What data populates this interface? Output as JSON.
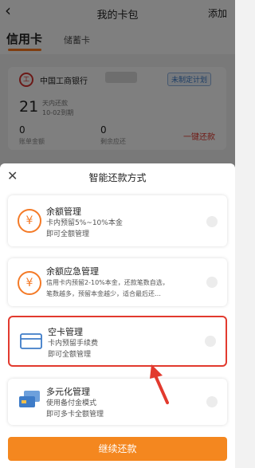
{
  "nav": {
    "back_icon": "back-arrow-icon",
    "title": "我的卡包",
    "add": "添加"
  },
  "tabs": {
    "credit": "信用卡",
    "debit": "储蓄卡"
  },
  "card": {
    "bank_name": "中国工商银行",
    "plan_status": "未制定计划",
    "days": "21",
    "days_label": "天内还款",
    "due": "10-02到期",
    "bill_amount": "0",
    "bill_label": "账单金额",
    "remaining_amount": "0",
    "remaining_label": "剩余应还",
    "one_key": "一键还款"
  },
  "sheet": {
    "close_icon": "close-icon",
    "title": "智能还款方式",
    "options": [
      {
        "title": "余额管理",
        "desc1": "卡内预留5%~10%本金",
        "desc2": "即可全额管理",
        "icon": "yen-icon"
      },
      {
        "title": "余额应急管理",
        "desc1": "信用卡内预留2-10%本金，还款笔数自选，",
        "desc2": "笔数越多，预留本金越少，适合最后还…",
        "icon": "yen-icon"
      },
      {
        "title": "空卡管理",
        "desc1": "卡内预留手续费",
        "desc2": "即可全额管理",
        "icon": "card-icon"
      },
      {
        "title": "多元化管理",
        "desc1": "使用备付金模式",
        "desc2": "即可多卡全额管理",
        "icon": "multi-card-icon"
      }
    ],
    "continue": "继续还款"
  },
  "colors": {
    "accent": "#f4871f",
    "highlight": "#e23a2e",
    "bank_red": "#d9332e"
  }
}
